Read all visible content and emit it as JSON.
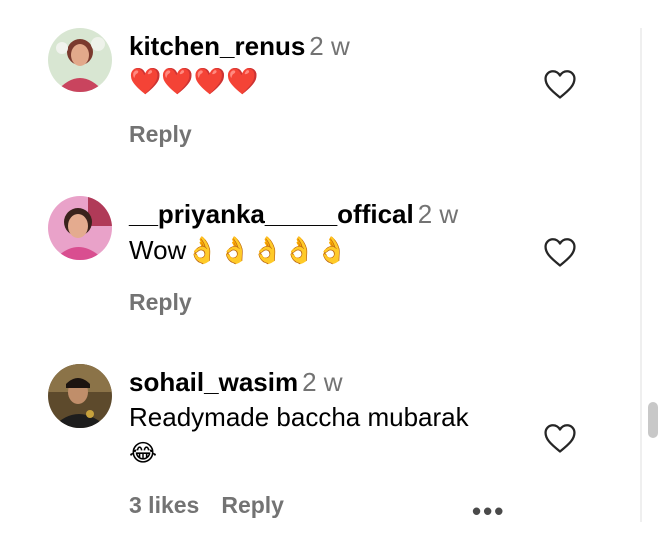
{
  "comments": [
    {
      "username": "kitchen_renus",
      "time": "2 w",
      "text": "❤️❤️❤️❤️",
      "actions": {
        "reply": "Reply"
      }
    },
    {
      "username": "__priyanka_____offical",
      "time": "2 w",
      "text": "Wow👌👌👌👌👌",
      "actions": {
        "reply": "Reply"
      }
    },
    {
      "username": "sohail_wasim",
      "time": "2 w",
      "text": "Readymade baccha mubarak",
      "emoji": "😂",
      "actions": {
        "likes": "3 likes",
        "reply": "Reply",
        "more": "•••"
      }
    }
  ],
  "icons": {
    "like": "heart-outline-icon",
    "more": "ellipsis-icon"
  },
  "colors": {
    "secondary_text": "#737373",
    "primary_text": "#000000",
    "background": "#ffffff"
  }
}
